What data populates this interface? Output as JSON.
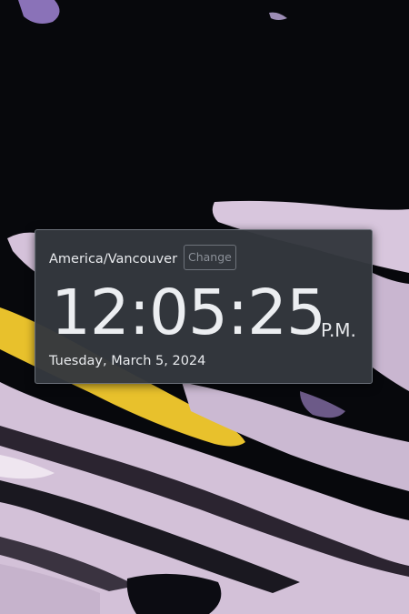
{
  "clock": {
    "timezone": "America/Vancouver",
    "change_label": "Change",
    "time": "12:05:25",
    "meridiem": "P.M.",
    "date": "Tuesday, March 5, 2024"
  },
  "colors": {
    "panel": "#34383e",
    "panel_border": "#6b7079",
    "text": "#eceef1",
    "muted_button": "#8b9098",
    "wallpaper_dark": "#07080c",
    "wallpaper_lilac": "#d8c6dd",
    "wallpaper_yellow": "#e8c12c"
  }
}
